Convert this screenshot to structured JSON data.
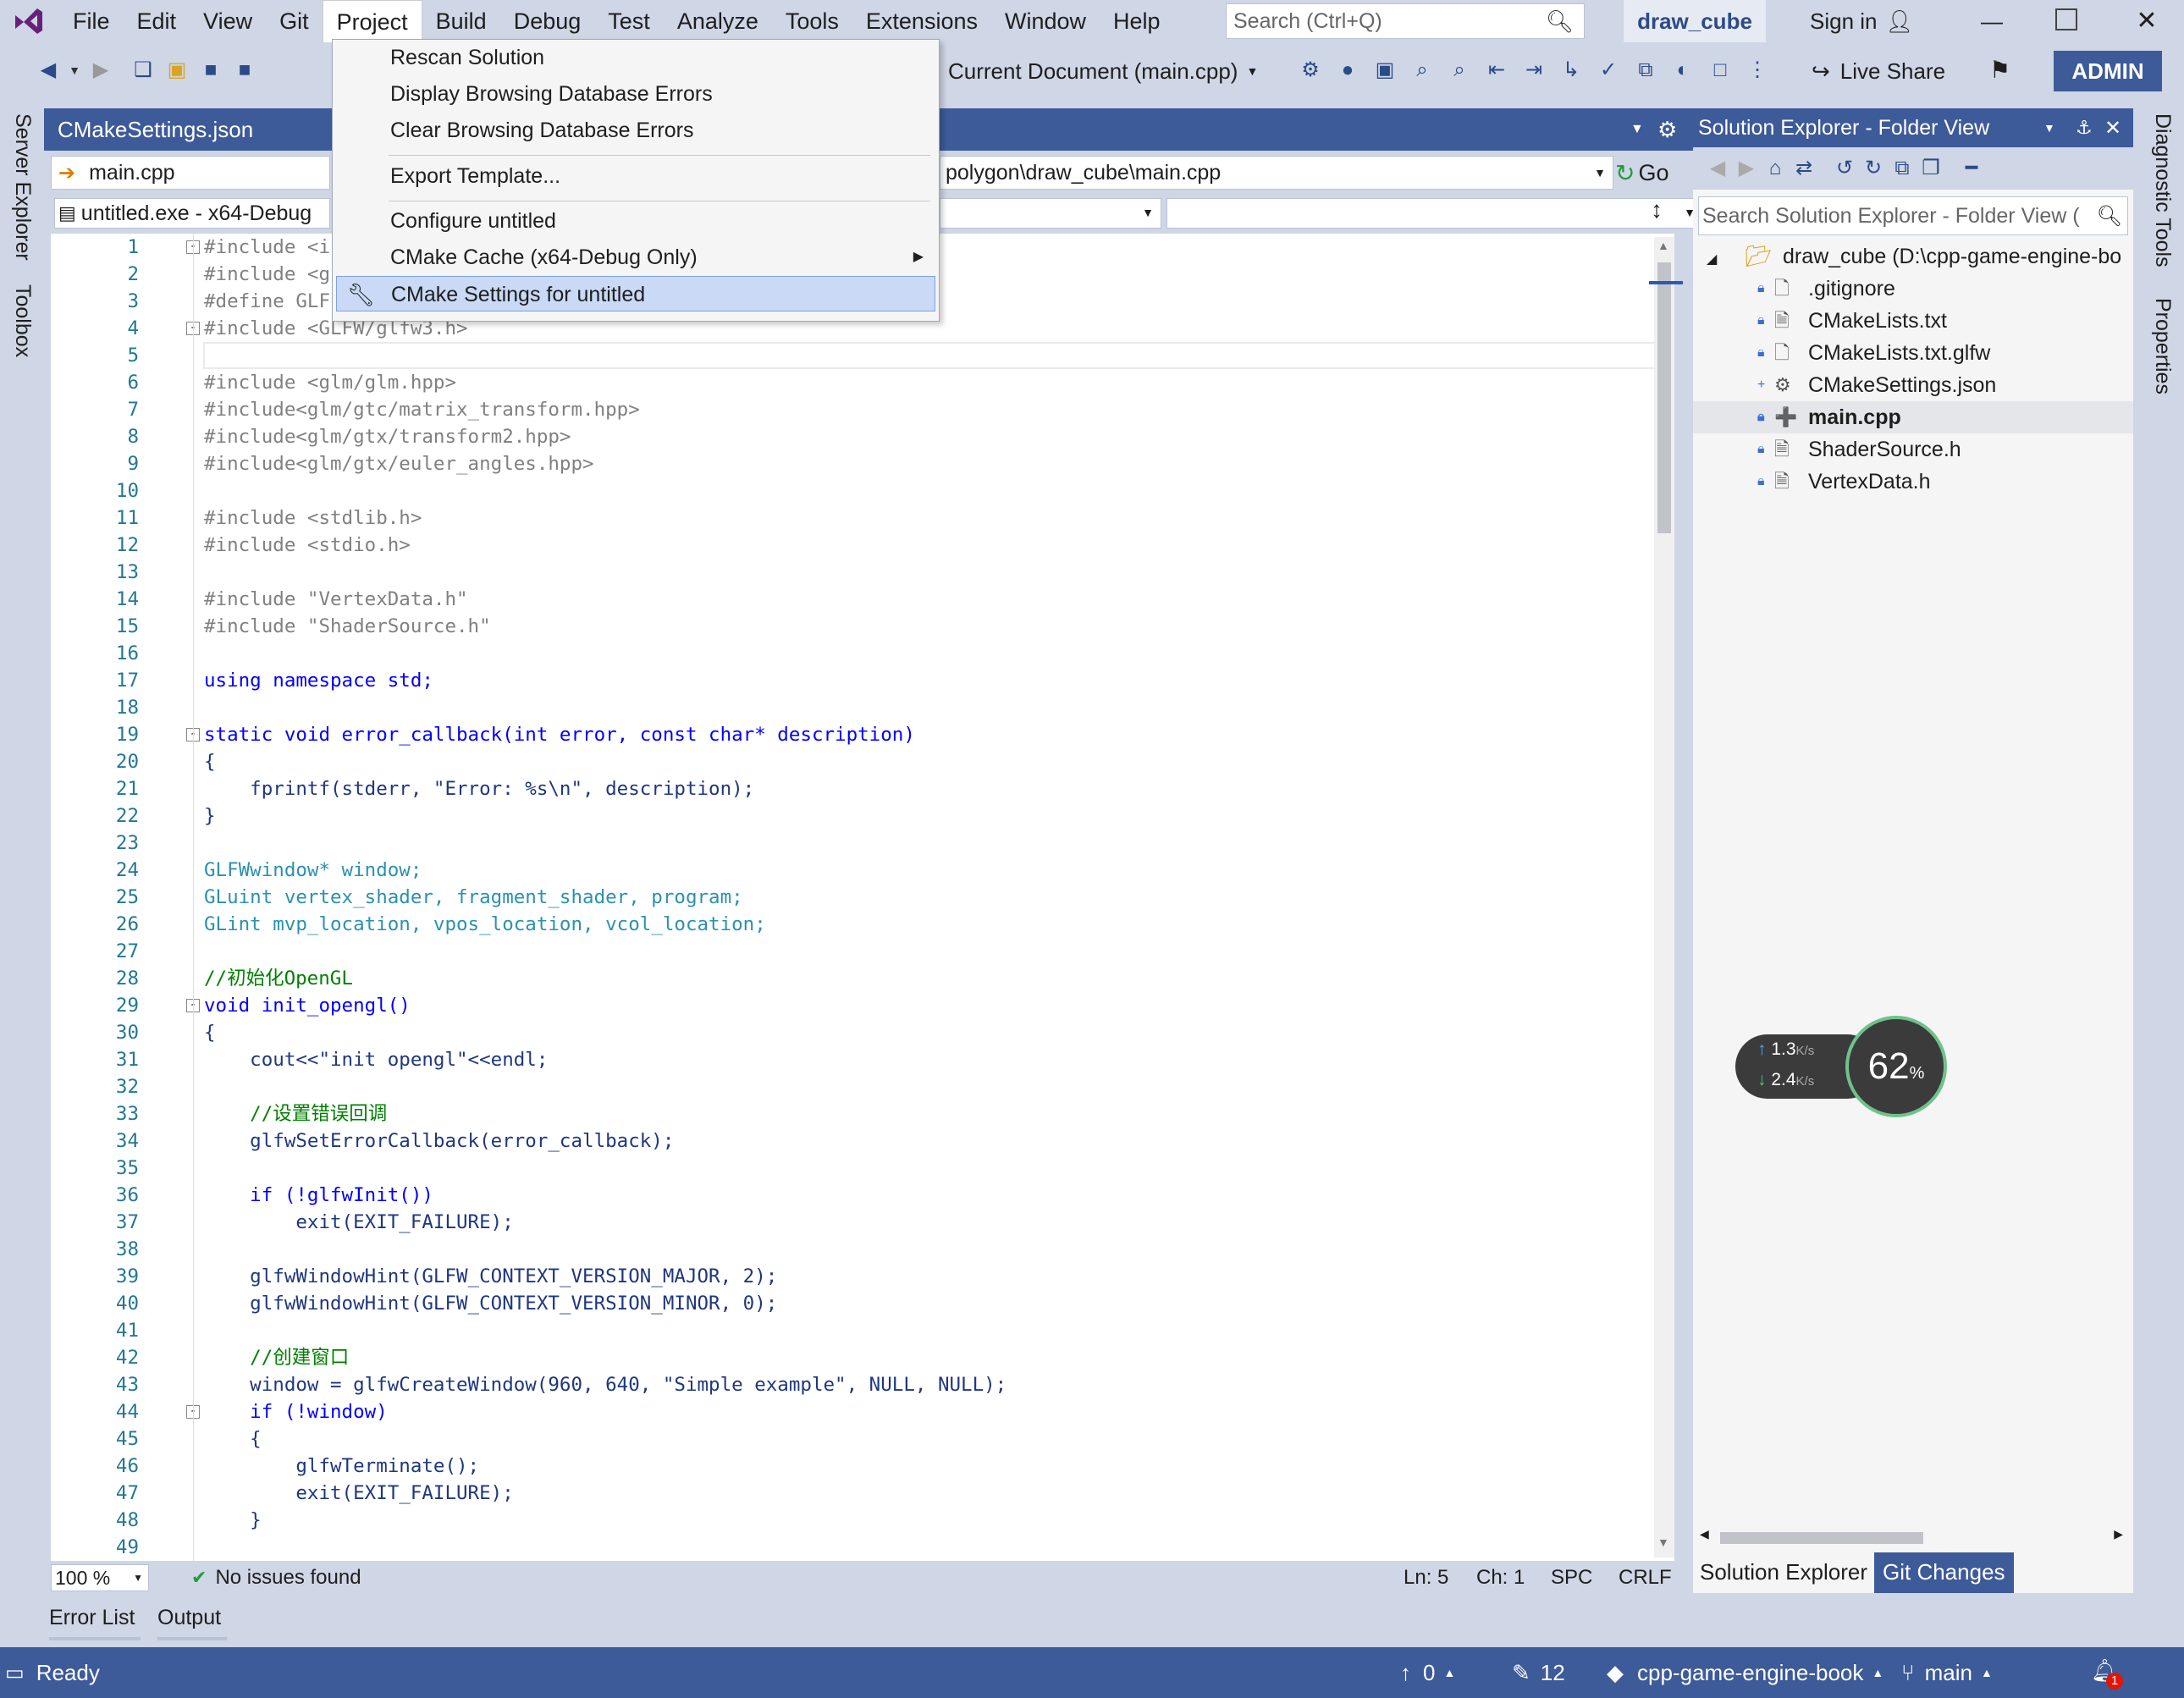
{
  "titlebar": {
    "menu": [
      "File",
      "Edit",
      "View",
      "Git",
      "Project",
      "Build",
      "Debug",
      "Test",
      "Analyze",
      "Tools",
      "Extensions",
      "Window",
      "Help"
    ],
    "search_placeholder": "Search (Ctrl+Q)",
    "solution_name": "draw_cube",
    "sign_in": "Sign in"
  },
  "toolbar": {
    "scope": "Current Document (main.cpp)",
    "live_share": "Live Share",
    "admin": "ADMIN"
  },
  "left_strip": [
    "Server Explorer",
    "Toolbox"
  ],
  "right_strip": [
    "Diagnostic Tools",
    "Properties"
  ],
  "editor": {
    "tab_label": "CMakeSettings.json",
    "file_dropdown": "main.cpp",
    "path_dropdown": "polygon\\draw_cube\\main.cpp",
    "go_label": "Go",
    "target_dropdown": "untitled.exe - x64-Debug",
    "zoom": "100 %",
    "issues": "No issues found",
    "ln": "Ln: 5",
    "ch": "Ch: 1",
    "spc": "SPC",
    "crlf": "CRLF"
  },
  "code_lines": [
    "#include <i",
    "#include <g",
    "#define GLF",
    "#include <GLFW/glfw3.h>",
    "",
    "#include <glm/glm.hpp>",
    "#include<glm/gtc/matrix_transform.hpp>",
    "#include<glm/gtx/transform2.hpp>",
    "#include<glm/gtx/euler_angles.hpp>",
    "",
    "#include <stdlib.h>",
    "#include <stdio.h>",
    "",
    "#include \"VertexData.h\"",
    "#include \"ShaderSource.h\"",
    "",
    "using namespace std;",
    "",
    "static void error_callback(int error, const char* description)",
    "{",
    "    fprintf(stderr, \"Error: %s\\n\", description);",
    "}",
    "",
    "GLFWwindow* window;",
    "GLuint vertex_shader, fragment_shader, program;",
    "GLint mvp_location, vpos_location, vcol_location;",
    "",
    "//初始化OpenGL",
    "void init_opengl()",
    "{",
    "    cout<<\"init opengl\"<<endl;",
    "",
    "    //设置错误回调",
    "    glfwSetErrorCallback(error_callback);",
    "",
    "    if (!glfwInit())",
    "        exit(EXIT_FAILURE);",
    "",
    "    glfwWindowHint(GLFW_CONTEXT_VERSION_MAJOR, 2);",
    "    glfwWindowHint(GLFW_CONTEXT_VERSION_MINOR, 0);",
    "",
    "    //创建窗口",
    "    window = glfwCreateWindow(960, 640, \"Simple example\", NULL, NULL);",
    "    if (!window)",
    "    {",
    "        glfwTerminate();",
    "        exit(EXIT_FAILURE);",
    "    }",
    ""
  ],
  "project_menu": {
    "items": [
      "Rescan Solution",
      "Display Browsing Database Errors",
      "Clear Browsing Database Errors",
      "Export Template...",
      "Configure untitled",
      "CMake Cache (x64-Debug Only)",
      "CMake Settings for untitled"
    ]
  },
  "solution_explorer": {
    "title": "Solution Explorer - Folder View",
    "search_placeholder": "Search Solution Explorer - Folder View (",
    "root": "draw_cube (D:\\cpp-game-engine-bo",
    "files": [
      ".gitignore",
      "CMakeLists.txt",
      "CMakeLists.txt.glfw",
      "CMakeSettings.json",
      "main.cpp",
      "ShaderSource.h",
      "VertexData.h"
    ],
    "tab_active": "Solution Explorer",
    "tab_other": "Git Changes"
  },
  "net_widget": {
    "up": "1.3",
    "down": "2.4",
    "unit": "K/s",
    "percent": "62",
    "percent_unit": "%"
  },
  "bottom_tabs": [
    "Error List",
    "Output"
  ],
  "statusbar": {
    "ready": "Ready",
    "push_count": "0",
    "changes": "12",
    "repo": "cpp-game-engine-book",
    "branch": "main",
    "notifications": "1"
  }
}
